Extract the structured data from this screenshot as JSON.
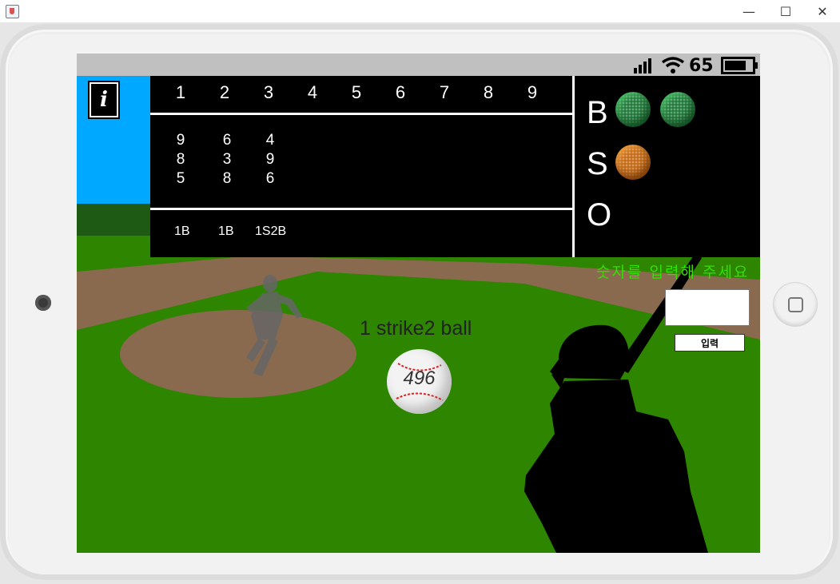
{
  "window": {
    "minimize_glyph": "—",
    "maximize_glyph": "☐",
    "close_glyph": "✕"
  },
  "statusbar": {
    "battery_level": "65"
  },
  "info_button": {
    "glyph": "i"
  },
  "scoreboard": {
    "innings": [
      "1",
      "2",
      "3",
      "4",
      "5",
      "6",
      "7",
      "8",
      "9"
    ],
    "guesses": [
      [
        "9",
        "8",
        "5"
      ],
      [
        "6",
        "3",
        "8"
      ],
      [
        "4",
        "9",
        "6"
      ]
    ],
    "results": [
      "1B",
      "1B",
      "1S2B"
    ],
    "bso_labels": {
      "balls": "B",
      "strikes": "S",
      "outs": "O"
    },
    "count": {
      "balls": 2,
      "strikes": 1,
      "outs": 0
    },
    "colors": {
      "ball_lamp": "#1f7a3a",
      "strike_lamp": "#c66a14"
    }
  },
  "input_panel": {
    "prompt": "숫자를 입력해 주세요",
    "value": "",
    "submit_label": "입력",
    "prompt_color": "#33e000"
  },
  "play": {
    "message": "1 strike2 ball",
    "ball_number": "496"
  },
  "icons": [
    "java-app-icon",
    "signal-icon",
    "wifi-icon",
    "battery-icon",
    "info-icon",
    "home-button-icon"
  ]
}
